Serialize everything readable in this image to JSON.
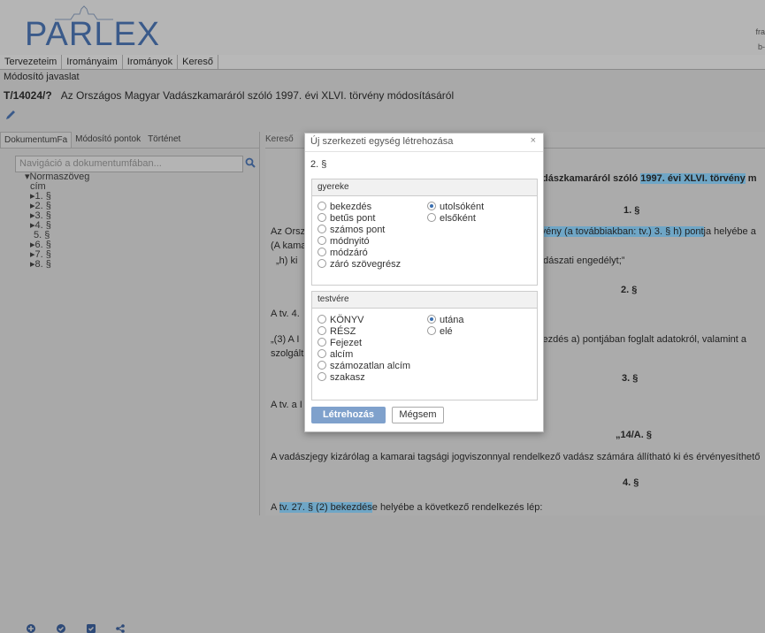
{
  "header": {
    "logo": "PARLEX",
    "right_line1": "fra",
    "right_line2": "b-"
  },
  "menu": [
    "Tervezeteim",
    "Irományaim",
    "Irományok",
    "Kereső"
  ],
  "proposal": {
    "type": "Módosító javaslat",
    "id": "T/14024/?",
    "title": "Az Országos Magyar Vadászkamaráról szóló 1997. évi XLVI. törvény módosításáról"
  },
  "left_tabs": [
    "DokumentumFa",
    "Módosító pontok",
    "Történet"
  ],
  "search": {
    "placeholder": "Navigáció a dokumentumfában..."
  },
  "tree": [
    "▾Normaszöveg",
    "cím",
    "▸1. §",
    "▸2. §",
    "▸3. §",
    "▸4. §",
    "5. §",
    "▸6. §",
    "▸7. §",
    "▸8. §"
  ],
  "doc": {
    "tab": "Kereső",
    "heading": "dászkamaráról szóló 1997. évi XLVI. törvény m",
    "heading_hl": "1997. évi XLVI. törvény",
    "s1": "1. §",
    "l1a": "Az Orsz",
    "l1b": "rvény (a továbbiakban: tv.) 3. § h) pont",
    "l1c": "ja helyébe a",
    "l2a": "(A kama",
    "l3a": "„h) ki",
    "l3b": "adászati engedélyt;”",
    "s2": "2. §",
    "l4": "A tv. 4.",
    "l5a": "„(3) A I",
    "l5b": "kezdés a) pontjában foglalt adatokról, valamint a",
    "l6": "szolgált",
    "s3": "3. §",
    "l7": "A tv. a I",
    "quote": "„14/A. §",
    "l8": "A vadászjegy kizárólag a kamarai tagsági jogviszonnyal rendelkező vadász számára állítható ki és érvényesíthető",
    "s4": "4. §",
    "l9a": "A ",
    "l9b": "tv. 27. § (2) bekezdés",
    "l9c": "e helyébe a következő rendelkezés lép:"
  },
  "modal": {
    "title": "Új szerkezeti egység létrehozása",
    "close": "×",
    "subtitle": "2. §",
    "group1": {
      "title": "gyereke",
      "options": [
        "bekezdés",
        "betűs pont",
        "számos pont",
        "módnyitó",
        "módzáró",
        "záró szövegrész"
      ],
      "pos_options": [
        "utolsóként",
        "elsőként"
      ],
      "pos_selected": "utolsóként"
    },
    "group2": {
      "title": "testvére",
      "options": [
        "KÖNYV",
        "RÉSZ",
        "Fejezet",
        "alcím",
        "számozatlan alcím",
        "szakasz"
      ],
      "pos_options": [
        "utána",
        "elé"
      ],
      "pos_selected": "utána"
    },
    "create_label": "Létrehozás",
    "cancel_label": "Mégsem"
  }
}
